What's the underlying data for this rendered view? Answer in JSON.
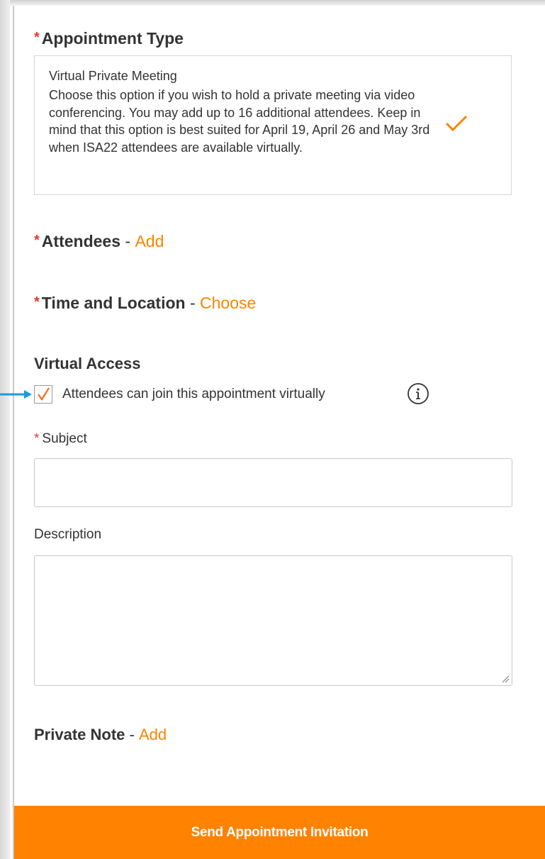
{
  "appointment_type": {
    "heading": "Appointment Type",
    "required_mark": "*",
    "option": {
      "title": "Virtual Private Meeting",
      "description": "Choose this option if you wish to hold a private meeting via video conferencing. You may add up to 16 additional attendees. Keep in mind that this option is best suited for April 19, April 26 and May 3rd when ISA22 attendees are available virtually.",
      "selected": true
    }
  },
  "attendees": {
    "heading": "Attendees",
    "separator": "-",
    "link": "Add",
    "required_mark": "*"
  },
  "time_location": {
    "heading": "Time and Location",
    "separator": "-",
    "link": "Choose",
    "required_mark": "*"
  },
  "virtual_access": {
    "heading": "Virtual Access",
    "checkbox_label": "Attendees can join this appointment virtually",
    "checked": true,
    "info_icon": "info-circle-icon"
  },
  "subject": {
    "label": "Subject",
    "required_mark": "*",
    "value": ""
  },
  "description": {
    "label": "Description",
    "value": ""
  },
  "private_note": {
    "heading": "Private Note",
    "separator": "-",
    "link": "Add"
  },
  "footer": {
    "send_label": "Send Appointment Invitation"
  },
  "colors": {
    "accent": "#ff8200",
    "required": "#e03b2e",
    "arrow": "#1a9be0"
  }
}
